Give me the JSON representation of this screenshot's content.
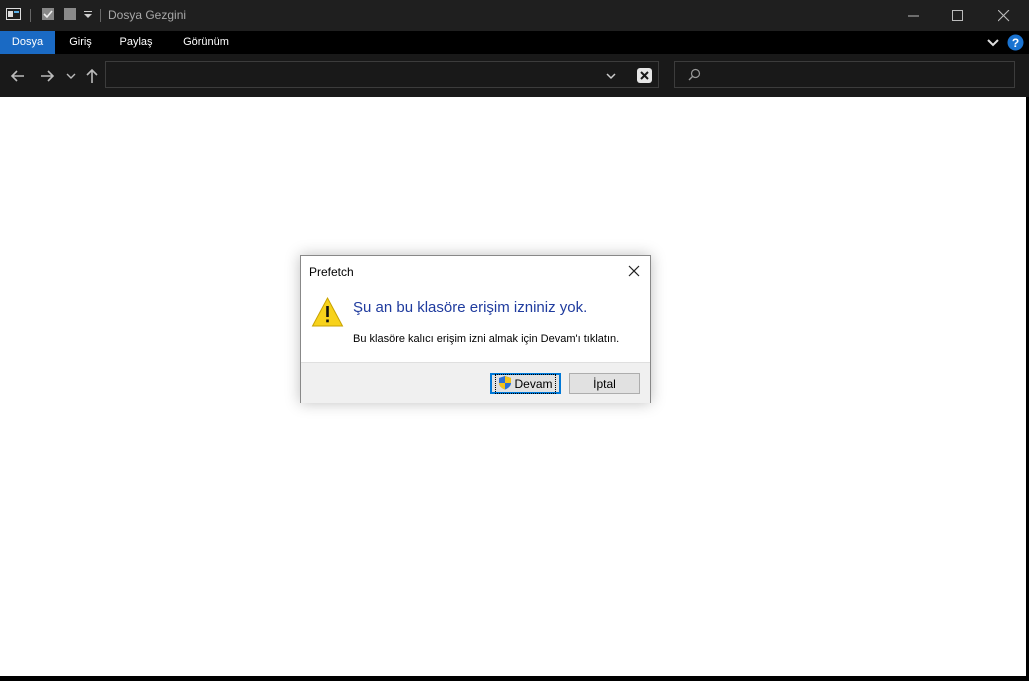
{
  "window": {
    "title": "Dosya Gezgini"
  },
  "ribbon": {
    "tabs": [
      {
        "label": "Dosya",
        "active": true
      },
      {
        "label": "Giriş",
        "active": false
      },
      {
        "label": "Paylaş",
        "active": false
      },
      {
        "label": "Görünüm",
        "active": false
      }
    ]
  },
  "address_bar": {
    "value": ""
  },
  "search_box": {
    "value": ""
  },
  "dialog": {
    "title": "Prefetch",
    "heading": "Şu an bu klasöre erişim izniniz yok.",
    "message": "Bu klasöre kalıcı erişim izni almak için Devam'ı tıklatın.",
    "continue_label": "Devam",
    "cancel_label": "İptal"
  },
  "colors": {
    "accent": "#1a6ac4",
    "heading_text": "#1f3b9e",
    "titlebar_bg": "#1f1f1f",
    "navbar_bg": "#191919"
  },
  "icons": [
    "properties-icon",
    "checkmark-icon",
    "new-folder-icon",
    "customize-dropdown-icon",
    "minimize-icon",
    "maximize-icon",
    "close-icon",
    "expand-ribbon-icon",
    "help-icon",
    "back-icon",
    "forward-icon",
    "recent-locations-icon",
    "up-icon",
    "address-dropdown-icon",
    "refresh-icon",
    "search-icon",
    "warning-icon",
    "uac-shield-icon"
  ]
}
